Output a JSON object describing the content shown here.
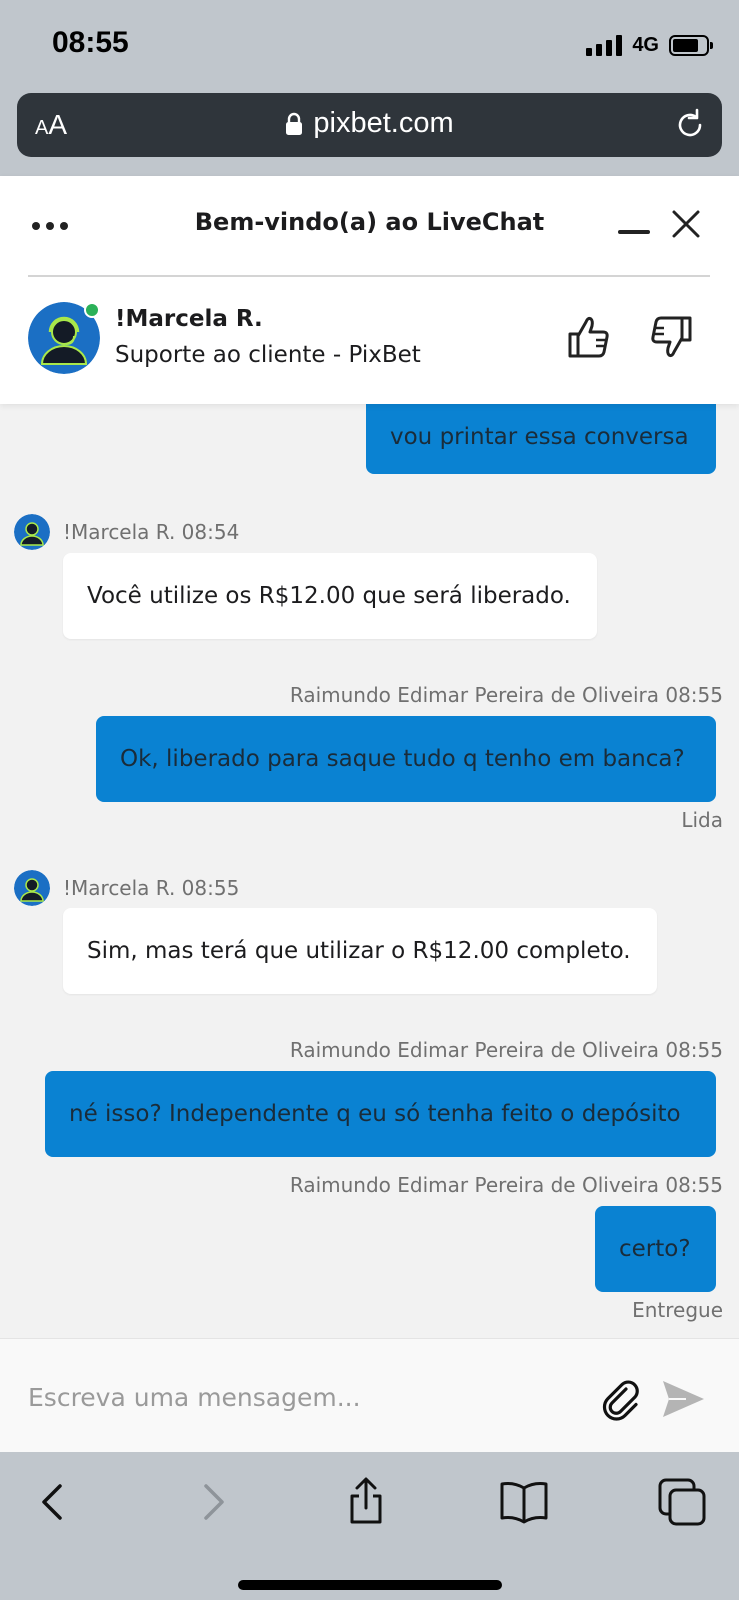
{
  "status_bar": {
    "time": "08:55",
    "network": "4G"
  },
  "browser": {
    "text_size_small": "A",
    "text_size_big": "A",
    "url": "pixbet.com"
  },
  "chat": {
    "title": "Bem-vindo(a) ao LiveChat",
    "agent": {
      "name": "!Marcela R.",
      "role": "Suporte ao cliente - PixBet",
      "status_color": "#2bb158"
    },
    "messages": [
      {
        "direction": "out",
        "text": "vou printar essa conversa"
      },
      {
        "direction": "in",
        "meta": "!Marcela R. 08:54",
        "text": "Você utilize os R$12.00 que será liberado."
      },
      {
        "direction": "out",
        "meta": "Raimundo Edimar Pereira de Oliveira 08:55",
        "text": "Ok, liberado para saque tudo q tenho em banca?",
        "status": "Lida"
      },
      {
        "direction": "in",
        "meta": "!Marcela R. 08:55",
        "text": "Sim, mas terá que utilizar o R$12.00 completo."
      },
      {
        "direction": "out",
        "meta": "Raimundo Edimar Pereira de Oliveira 08:55",
        "text": "né isso? Independente q eu só tenha feito o depósito"
      },
      {
        "direction": "out",
        "meta": "Raimundo Edimar Pereira de Oliveira 08:55",
        "text": "certo?",
        "status": "Entregue"
      }
    ],
    "composer": {
      "placeholder": "Escreva uma mensagem..."
    }
  },
  "colors": {
    "outgoing_bubble": "#0a82d2",
    "incoming_bubble": "#ffffff",
    "conversation_bg": "#f2f2f2",
    "browser_chrome": "#c0c6cc"
  },
  "icons": [
    "menu-dots-icon",
    "minimize-icon",
    "close-icon",
    "thumbs-up-icon",
    "thumbs-down-icon",
    "paperclip-icon",
    "send-icon",
    "lock-icon",
    "reload-icon",
    "back-icon",
    "forward-icon",
    "share-icon",
    "bookmarks-icon",
    "tabs-icon"
  ]
}
